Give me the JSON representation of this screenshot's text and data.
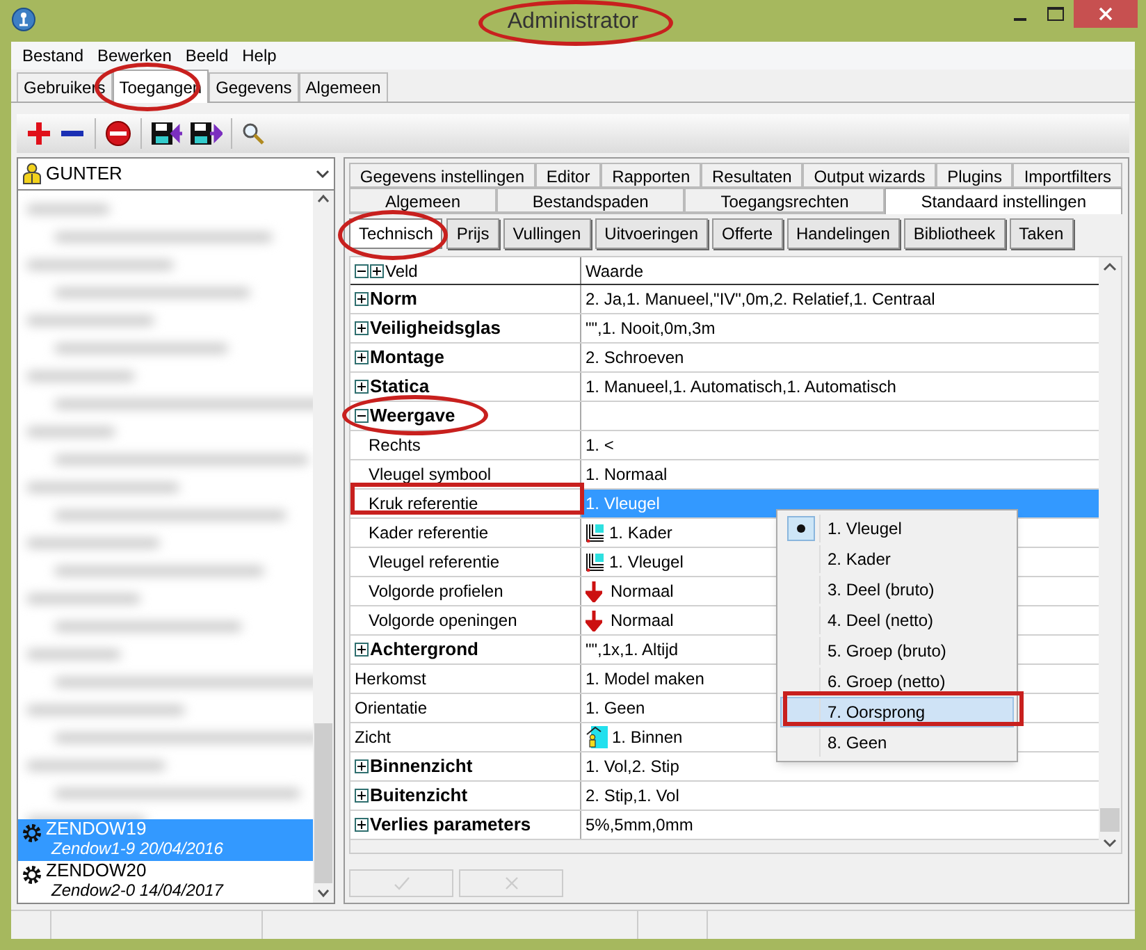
{
  "window": {
    "title": "Administrator"
  },
  "menu": [
    "Bestand",
    "Bewerken",
    "Beeld",
    "Help"
  ],
  "main_tabs": [
    {
      "label": "Gebruikers",
      "selected": false
    },
    {
      "label": "Toegangen",
      "selected": true
    },
    {
      "label": "Gegevens",
      "selected": false
    },
    {
      "label": "Algemeen",
      "selected": false
    }
  ],
  "user_select": {
    "value": "GUNTER"
  },
  "user_list": [
    {
      "name": "ZENDOW19",
      "detail": "Zendow1-9 20/04/2016",
      "selected": true
    },
    {
      "name": "ZENDOW20",
      "detail": "Zendow2-0 14/04/2017",
      "selected": false
    }
  ],
  "settings_tab_rows": [
    [
      {
        "label": "Gegevens instellingen",
        "selected": false
      },
      {
        "label": "Editor",
        "selected": false
      },
      {
        "label": "Rapporten",
        "selected": false
      },
      {
        "label": "Resultaten",
        "selected": false
      },
      {
        "label": "Output wizards",
        "selected": false
      },
      {
        "label": "Plugins",
        "selected": false
      },
      {
        "label": "Importfilters",
        "selected": false
      }
    ],
    [
      {
        "label": "Algemeen",
        "selected": false
      },
      {
        "label": "Bestandspaden",
        "selected": false
      },
      {
        "label": "Toegangsrechten",
        "selected": false
      },
      {
        "label": "Standaard instellingen",
        "selected": true
      }
    ]
  ],
  "sub_tabs": [
    {
      "label": "Technisch",
      "selected": true
    },
    {
      "label": "Prijs",
      "selected": false
    },
    {
      "label": "Vullingen",
      "selected": false
    },
    {
      "label": "Uitvoeringen",
      "selected": false
    },
    {
      "label": "Offerte",
      "selected": false
    },
    {
      "label": "Handelingen",
      "selected": false
    },
    {
      "label": "Bibliotheek",
      "selected": false
    },
    {
      "label": "Taken",
      "selected": false
    }
  ],
  "grid": {
    "columns": [
      "Veld",
      "Waarde"
    ],
    "rows": [
      {
        "kind": "group",
        "name": "Norm",
        "value": "2. Ja,1. Manueel,\"IV\",0m,2. Relatief,1. Centraal",
        "expanded": false,
        "selected": false
      },
      {
        "kind": "group",
        "name": "Veiligheidsglas",
        "value": "\"\",1. Nooit,0m,3m",
        "expanded": false,
        "selected": false
      },
      {
        "kind": "group",
        "name": "Montage",
        "value": "2. Schroeven",
        "expanded": false,
        "selected": false
      },
      {
        "kind": "group",
        "name": "Statica",
        "value": "1. Manueel,1. Automatisch,1. Automatisch",
        "expanded": false,
        "selected": false
      },
      {
        "kind": "group",
        "name": "Weergave",
        "expanded": true,
        "selected": false
      },
      {
        "kind": "child",
        "name": "Rechts",
        "value": "1. <",
        "selected": false
      },
      {
        "kind": "child",
        "name": "Vleugel symbool",
        "value": "1. Normaal",
        "selected": false
      },
      {
        "kind": "child",
        "name": "Kruk referentie",
        "value": "1. Vleugel",
        "selected": true
      },
      {
        "kind": "reference",
        "name": "Kader referentie",
        "value": "1. Kader",
        "selected": false
      },
      {
        "kind": "reference",
        "name": "Vleugel referentie",
        "value": "1. Vleugel",
        "selected": false
      },
      {
        "kind": "order",
        "name": "Volgorde profielen",
        "value": "Normaal",
        "selected": false
      },
      {
        "kind": "order",
        "name": "Volgorde openingen",
        "value": "Normaal",
        "selected": false
      },
      {
        "kind": "group",
        "name": "Achtergrond",
        "value": "\"\",1x,1. Altijd",
        "expanded": false,
        "selected": false
      },
      {
        "kind": "plain",
        "name": "Herkomst",
        "value": "1. Model maken",
        "selected": false
      },
      {
        "kind": "plain",
        "name": "Orientatie",
        "value": "1. Geen",
        "selected": false
      },
      {
        "kind": "view",
        "name": "Zicht",
        "value": "1. Binnen",
        "selected": false
      },
      {
        "kind": "group",
        "name": "Binnenzicht",
        "value": "1. Vol,2. Stip",
        "expanded": false,
        "selected": false
      },
      {
        "kind": "group",
        "name": "Buitenzicht",
        "value": "2. Stip,1. Vol",
        "expanded": false,
        "selected": false
      },
      {
        "kind": "group",
        "name": "Verlies parameters",
        "value": "5%,5mm,0mm",
        "expanded": false,
        "selected": false
      }
    ]
  },
  "dropdown": {
    "items": [
      {
        "label": "1. Vleugel",
        "checked": true,
        "highlighted": false
      },
      {
        "label": "2. Kader",
        "checked": false,
        "highlighted": false
      },
      {
        "label": "3. Deel (bruto)",
        "checked": false,
        "highlighted": false
      },
      {
        "label": "4. Deel (netto)",
        "checked": false,
        "highlighted": false
      },
      {
        "label": "5. Groep (bruto)",
        "checked": false,
        "highlighted": false
      },
      {
        "label": "6. Groep (netto)",
        "checked": false,
        "highlighted": false
      },
      {
        "label": "7. Oorsprong",
        "checked": false,
        "highlighted": true
      },
      {
        "label": "8. Geen",
        "checked": false,
        "highlighted": false
      }
    ]
  }
}
